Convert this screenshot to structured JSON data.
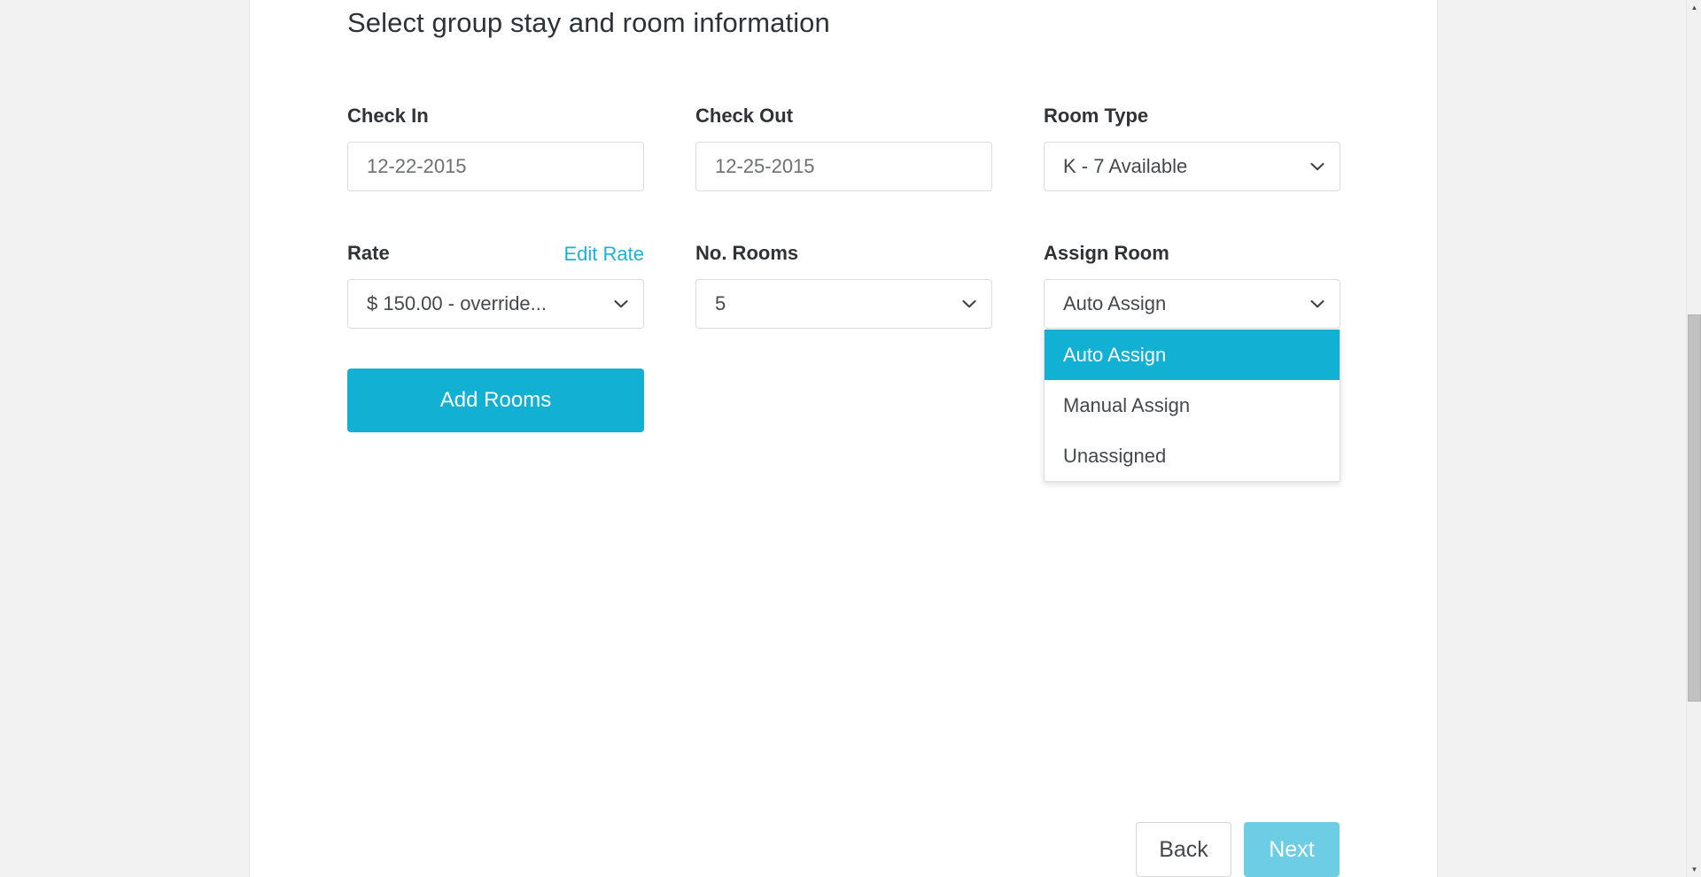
{
  "page": {
    "title": "Select group stay and room information"
  },
  "form": {
    "check_in": {
      "label": "Check In",
      "value": "12-22-2015",
      "placeholder": "12-22-2015"
    },
    "check_out": {
      "label": "Check Out",
      "value": "12-25-2015",
      "placeholder": "12-25-2015"
    },
    "room_type": {
      "label": "Room Type",
      "value": "K - 7 Available"
    },
    "rate": {
      "label": "Rate",
      "edit_link": "Edit Rate",
      "value": "$ 150.00 - override..."
    },
    "no_rooms": {
      "label": "No. Rooms",
      "value": "5"
    },
    "assign_room": {
      "label": "Assign Room",
      "value": "Auto Assign",
      "expanded": true,
      "options": [
        {
          "label": "Auto Assign",
          "selected": true
        },
        {
          "label": "Manual Assign",
          "selected": false
        },
        {
          "label": "Unassigned",
          "selected": false
        }
      ]
    }
  },
  "actions": {
    "add_rooms": "Add Rooms",
    "back": "Back",
    "next": "Next"
  },
  "colors": {
    "accent": "#12b0d3",
    "link": "#19b3d9",
    "next_disabled": "#6dcde4",
    "card_background": "#ffffff",
    "page_background": "#f2f2f2"
  },
  "scrollbar": {
    "up_arrow": "▲",
    "down_arrow": "▼"
  }
}
